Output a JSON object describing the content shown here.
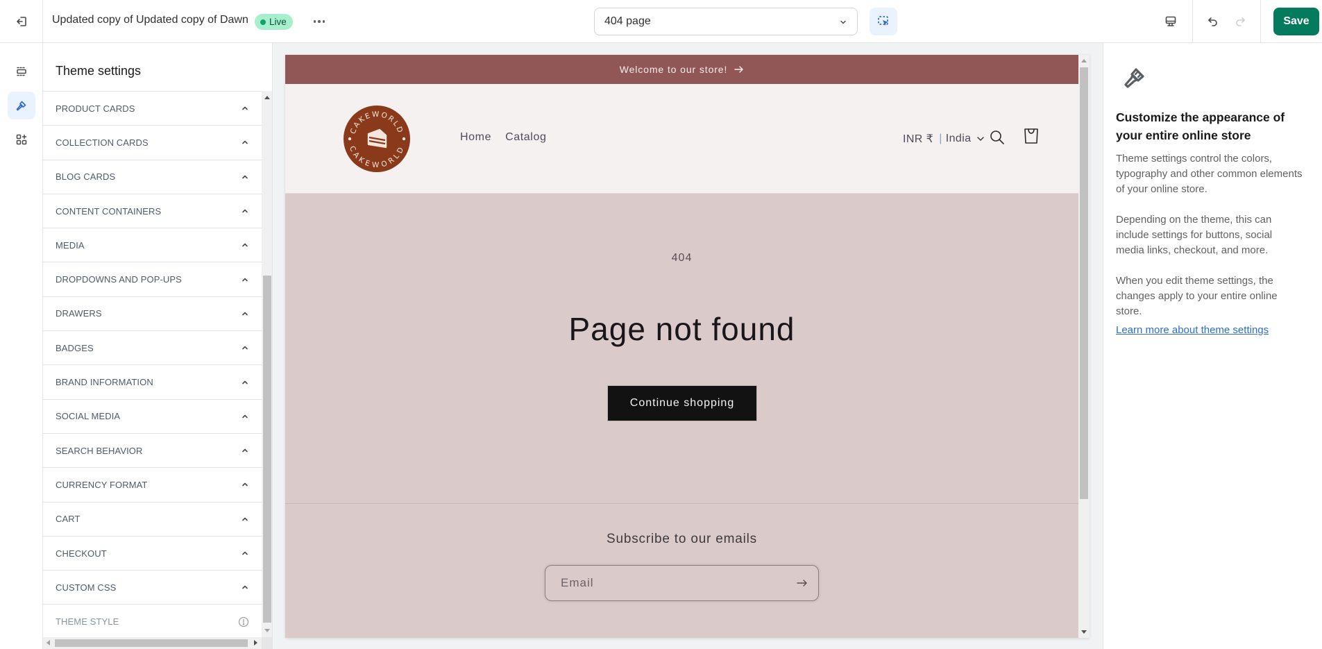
{
  "topbar": {
    "theme_name": "Updated copy of Updated copy of Dawn",
    "status_badge": "Live",
    "page_select_value": "404 page",
    "save_label": "Save"
  },
  "rail": {
    "items": [
      {
        "name": "sections",
        "icon": "sections-icon",
        "active": false
      },
      {
        "name": "theme-settings",
        "icon": "paintbrush-icon",
        "active": true
      },
      {
        "name": "apps",
        "icon": "apps-add-icon",
        "active": false
      }
    ]
  },
  "panel": {
    "title": "Theme settings",
    "items": [
      {
        "label": "PRODUCT CARDS",
        "icon": "chevron-up-icon"
      },
      {
        "label": "COLLECTION CARDS",
        "icon": "chevron-up-icon"
      },
      {
        "label": "BLOG CARDS",
        "icon": "chevron-up-icon"
      },
      {
        "label": "CONTENT CONTAINERS",
        "icon": "chevron-up-icon"
      },
      {
        "label": "MEDIA",
        "icon": "chevron-up-icon"
      },
      {
        "label": "DROPDOWNS AND POP-UPS",
        "icon": "chevron-up-icon"
      },
      {
        "label": "DRAWERS",
        "icon": "chevron-up-icon"
      },
      {
        "label": "BADGES",
        "icon": "chevron-up-icon"
      },
      {
        "label": "BRAND INFORMATION",
        "icon": "chevron-up-icon"
      },
      {
        "label": "SOCIAL MEDIA",
        "icon": "chevron-up-icon"
      },
      {
        "label": "SEARCH BEHAVIOR",
        "icon": "chevron-up-icon"
      },
      {
        "label": "CURRENCY FORMAT",
        "icon": "chevron-up-icon"
      },
      {
        "label": "CART",
        "icon": "chevron-up-icon"
      },
      {
        "label": "CHECKOUT",
        "icon": "chevron-up-icon"
      },
      {
        "label": "CUSTOM CSS",
        "icon": "chevron-up-icon"
      },
      {
        "label": "THEME STYLE",
        "icon": "info-icon"
      }
    ]
  },
  "preview": {
    "announcement": "Welcome to our store!",
    "logo_text": "CAKEWORLD",
    "nav": [
      "Home",
      "Catalog"
    ],
    "currency": "INR ₹",
    "country": "India",
    "error_code": "404",
    "heading": "Page not found",
    "continue_label": "Continue shopping",
    "newsletter_title": "Subscribe to our emails",
    "email_placeholder": "Email",
    "colors": {
      "announcement_bg": "#915656",
      "header_bg": "#f6f1f1",
      "body_bg": "#dacaca",
      "button_bg": "#121212",
      "logo_brown": "#8a3a1a"
    }
  },
  "info": {
    "title": "Customize the appearance of your entire online store",
    "paragraphs": [
      "Theme settings control the colors, typography and other common elements of your online store.",
      "Depending on the theme, this can include settings for buttons, social media links, checkout, and more.",
      "When you edit theme settings, the changes apply to your entire online store."
    ],
    "link": "Learn more about theme settings"
  },
  "colors": {
    "save_green": "#047b5d",
    "accent_blue": "#2c6ecb",
    "live_badge": "#a7f0cf"
  }
}
